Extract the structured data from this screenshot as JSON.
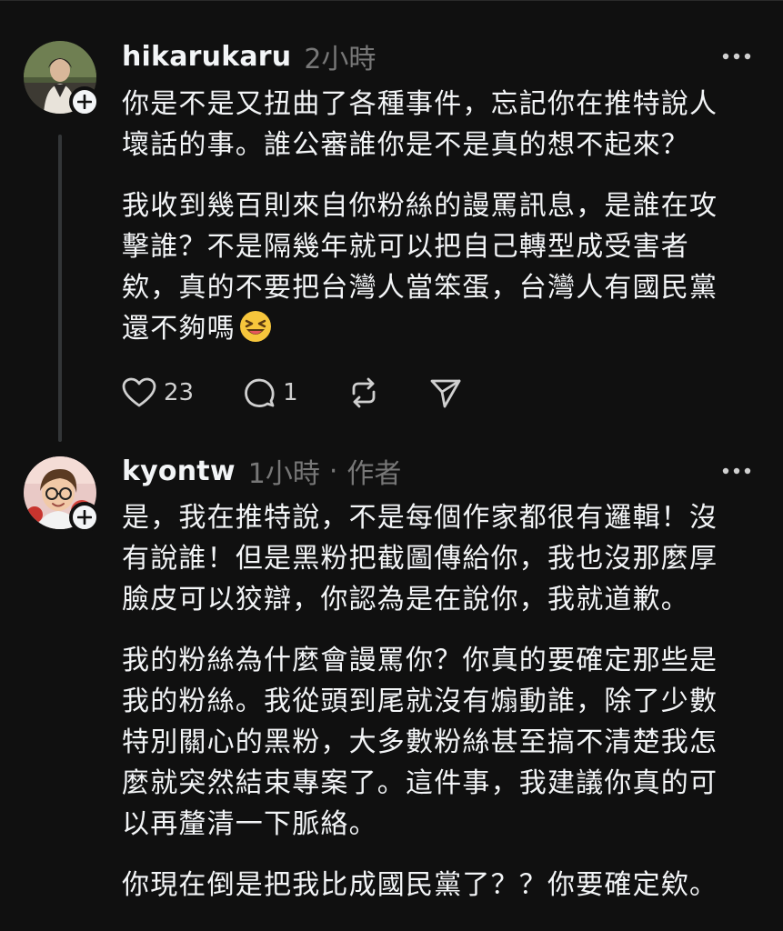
{
  "posts": [
    {
      "username": "hikarukaru",
      "time": "2小時",
      "author_tag": "",
      "paragraphs": [
        "你是不是又扭曲了各種事件，忘記你在推特說人\n壞話的事。誰公審誰你是不是真的想不起來？",
        "我收到幾百則來自你粉絲的謾罵訊息，是誰在攻\n擊誰？不是隔幾年就可以把自己轉型成受害者\n欸，真的不要把台灣人當笨蛋，台灣人有國民黨\n還不夠嗎"
      ],
      "emoji": "😆",
      "likes": "23",
      "replies": "1"
    },
    {
      "username": "kyontw",
      "time": "1小時",
      "separator": "·",
      "author_tag": "作者",
      "paragraphs": [
        "是，我在推特說，不是每個作家都很有邏輯！沒\n有說誰！但是黑粉把截圖傳給你，我也沒那麼厚\n臉皮可以狡辯，你認為是在說你，我就道歉。",
        "我的粉絲為什麼會謾罵你？你真的要確定那些是\n我的粉絲。我從頭到尾就沒有煽動誰，除了少數\n特別關心的黑粉，大多數粉絲甚至搞不清楚我怎\n麼就突然結束專案了。這件事，我建議你真的可\n以再釐清一下脈絡。",
        "你現在倒是把我比成國民黨了？？你要確定欸。"
      ]
    }
  ],
  "icons": {
    "more": "more-horizontal-icon",
    "like": "heart-icon",
    "reply": "comment-icon",
    "repost": "repost-icon",
    "share": "send-icon",
    "follow": "plus-icon"
  },
  "colors": {
    "background": "#101010",
    "text": "#f3f5f7",
    "muted": "#777777",
    "thread_line": "#333638"
  }
}
